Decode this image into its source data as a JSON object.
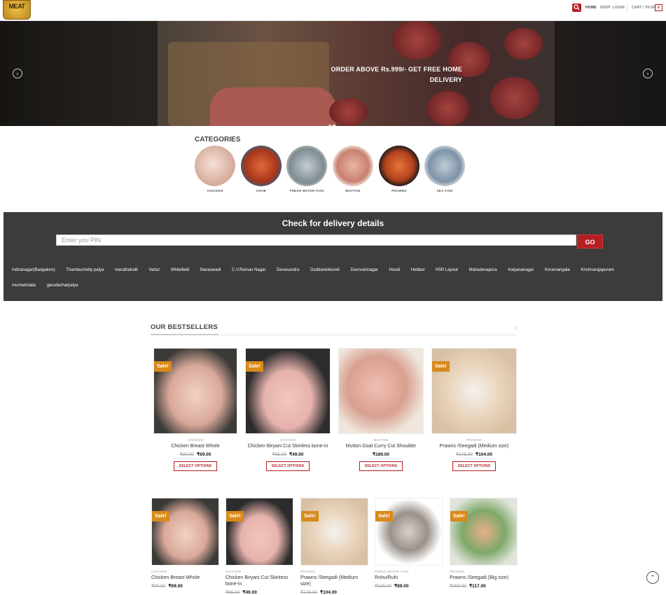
{
  "header": {
    "logo_text": "MEAT",
    "nav": {
      "home": "HOME",
      "shop": "SHOP",
      "login": "LOGIN",
      "cart": "CART / ₹0.00",
      "cart_count": "0"
    },
    "icons": [
      "search-icon"
    ],
    "accent": "#b41f24"
  },
  "slider": {
    "text_line1": "ORDER ABOVE Rs.999/- GET FREE HOME",
    "text_line2": "DELIVERY",
    "prev": "‹",
    "next": "›"
  },
  "categories": {
    "title": "CATEGORIES",
    "items": [
      {
        "label": "CHICKEN",
        "color": "#e8c8b8"
      },
      {
        "label": "CRAB",
        "color": "#c2532a"
      },
      {
        "label": "FRESH WATER FISH",
        "color": "#8a98a0"
      },
      {
        "label": "MUTTON",
        "color": "#d99a8c"
      },
      {
        "label": "PRAWNS",
        "color": "#d4622e"
      },
      {
        "label": "SEA FISH",
        "color": "#9ab0c0"
      }
    ]
  },
  "delivery": {
    "title": "Check for delivery details",
    "placeholder": "Enter you PIN",
    "go": "GO",
    "areas": [
      "Indiranagar(Bangalore)",
      "Thambuchetty palya",
      "marathahalli",
      "Vartur",
      "Whitefield",
      "Banaswadi",
      "C.V.Raman Nagar",
      "Devasandra",
      "Doddanekkundi",
      "Doorvaninagar",
      "Hoodi",
      "Hebbal",
      "HSR Layout",
      "Mahadevapura",
      "Kalyananagar",
      "Koramangala",
      "Krishnarajapuram",
      "munnekolala",
      "garudacharpalya"
    ]
  },
  "bestsellers": {
    "title": "OUR BESTSELLERS",
    "next": "›",
    "select_label": "SELECT OPTIONS",
    "sale_label": "Sale!",
    "row1": [
      {
        "category": "CHICKEN",
        "name": "Chicken Breast Whole",
        "old": "₹90.00",
        "price": "₹69.00",
        "sale": true,
        "color": "#d9a89a"
      },
      {
        "category": "CHICKEN",
        "name": "Chicken Biryani Cut Skinless bone-in",
        "old": "₹65.00",
        "price": "₹49.00",
        "sale": true,
        "color": "#e6b2ac"
      },
      {
        "category": "MUTTON",
        "name": "Mutton Goat Curry Cut Shoulder",
        "old": "",
        "price": "₹189.00",
        "sale": false,
        "color": "#d8a090"
      },
      {
        "category": "PRAWNS",
        "name": "Prawns /Seegadi (Medium size)",
        "old": "₹175.00",
        "price": "₹104.00",
        "sale": true,
        "color": "#e9d4bc"
      }
    ],
    "row2": [
      {
        "category": "CHICKEN",
        "name": "Chicken Breast Whole",
        "old": "₹90.00",
        "price": "₹69.00",
        "sale": true,
        "color": "#d9a89a"
      },
      {
        "category": "CHICKEN",
        "name": "Chicken Biryani Cut Skinless bone-in",
        "old": "₹65.00",
        "price": "₹49.00",
        "sale": true,
        "color": "#e6b2ac"
      },
      {
        "category": "PRAWNS",
        "name": "Prawns /Seegadi (Medium size)",
        "old": "₹175.00",
        "price": "₹104.00",
        "sale": true,
        "color": "#e9d4bc"
      },
      {
        "category": "FRESH WATER FISH",
        "name": "Rohu/Ruhi",
        "old": "₹125.00",
        "price": "₹89.00",
        "sale": true,
        "color": "#c9c2bd"
      },
      {
        "category": "PRAWNS",
        "name": "Prawns /Seegadi (Big size)",
        "old": "₹200.00",
        "price": "₹117.00",
        "sale": true,
        "color": "#d7e2cc"
      }
    ]
  },
  "back_to_top": "⌃"
}
